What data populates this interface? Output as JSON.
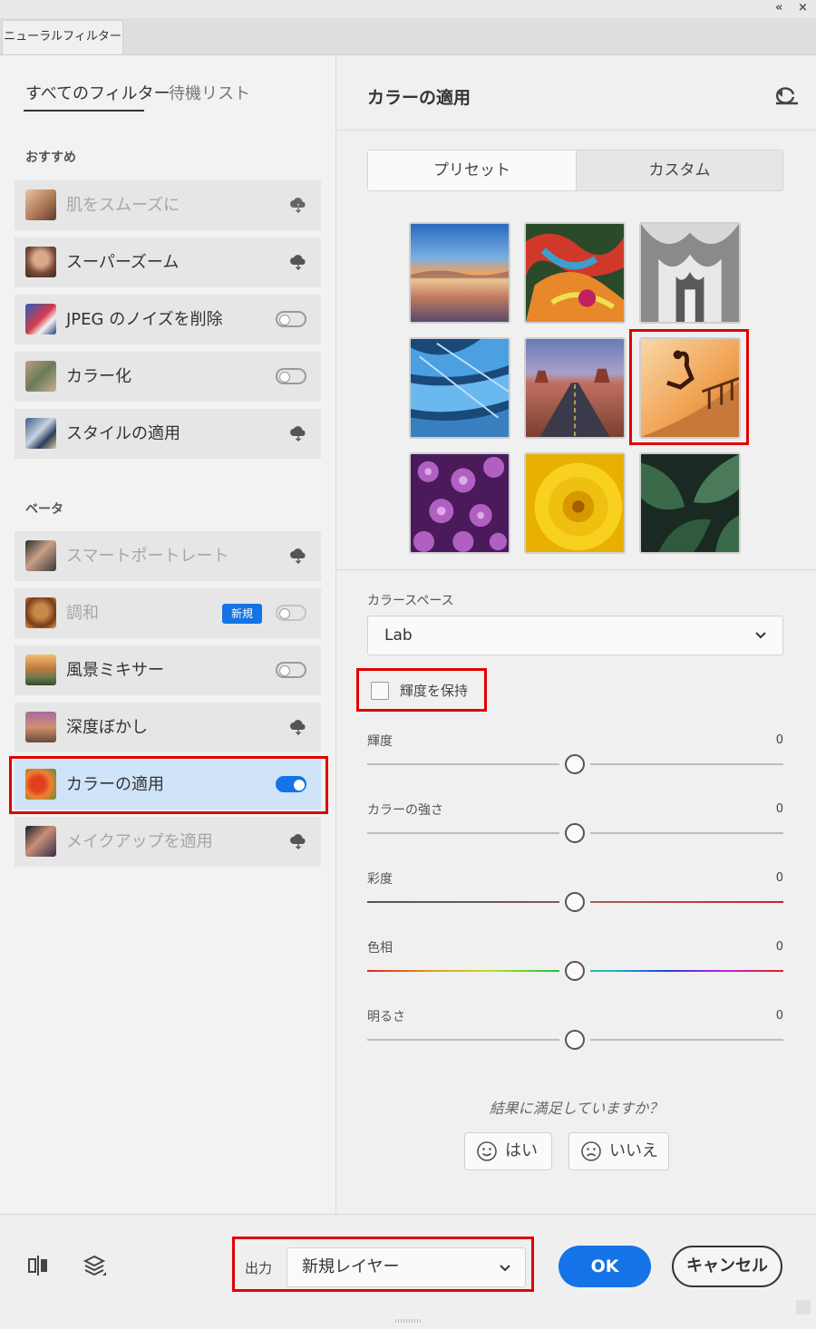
{
  "window": {
    "collapse_glyph": "«",
    "close_glyph": "×",
    "tab_title": "ニューラルフィルター"
  },
  "left": {
    "tabs": [
      "すべてのフィルター",
      "待機リスト"
    ],
    "section_recommended": "おすすめ",
    "section_beta": "ベータ",
    "recommended": [
      {
        "label": "肌をスムーズに",
        "control": "cloud-download-icon",
        "dim": true
      },
      {
        "label": "スーパーズーム",
        "control": "cloud-download-icon",
        "dim": false
      },
      {
        "label": "JPEG のノイズを削除",
        "control": "toggle-off",
        "dim": false
      },
      {
        "label": "カラー化",
        "control": "toggle-off",
        "dim": false
      },
      {
        "label": "スタイルの適用",
        "control": "cloud-download-icon",
        "dim": false
      }
    ],
    "beta": [
      {
        "label": "スマートポートレート",
        "control": "cloud-download-icon",
        "dim": true
      },
      {
        "label": "調和",
        "control": "toggle-off",
        "dim": true,
        "badge": "新規"
      },
      {
        "label": "風景ミキサー",
        "control": "toggle-off",
        "dim": false
      },
      {
        "label": "深度ぼかし",
        "control": "cloud-download-icon",
        "dim": false
      },
      {
        "label": "カラーの適用",
        "control": "toggle-on",
        "dim": false,
        "selected": true
      },
      {
        "label": "メイクアップを適用",
        "control": "cloud-download-icon",
        "dim": true
      }
    ]
  },
  "right": {
    "title": "カラーの適用",
    "reset_icon": "reset-icon",
    "segments": [
      "プリセット",
      "カスタム"
    ],
    "active_segment": "プリセット",
    "presets": [
      {
        "name": "sunset-lake-preset"
      },
      {
        "name": "abstract-paint-preset"
      },
      {
        "name": "cathedral-bw-preset"
      },
      {
        "name": "blue-feathers-preset"
      },
      {
        "name": "desert-road-preset"
      },
      {
        "name": "orange-skater-preset",
        "selected": true
      },
      {
        "name": "purple-flowers-preset"
      },
      {
        "name": "yellow-flower-preset"
      },
      {
        "name": "monstera-leaves-preset"
      }
    ],
    "colorspace_label": "カラースペース",
    "colorspace_value": "Lab",
    "preserve_luminance_label": "輝度を保持",
    "preserve_luminance_checked": false,
    "sliders": [
      {
        "label": "輝度",
        "value": "0"
      },
      {
        "label": "カラーの強さ",
        "value": "0"
      },
      {
        "label": "彩度",
        "value": "0"
      },
      {
        "label": "色相",
        "value": "0"
      },
      {
        "label": "明るさ",
        "value": "0"
      }
    ],
    "feedback_question": "結果に満足していますか？",
    "feedback_yes": "はい",
    "feedback_no": "いいえ"
  },
  "footer": {
    "output_label": "出力",
    "output_value": "新規レイヤー",
    "ok": "OK",
    "cancel": "キャンセル"
  },
  "colors": {
    "accent": "#1473e6",
    "highlight_box": "#e00000",
    "selected_item": "#cfe3f9"
  }
}
